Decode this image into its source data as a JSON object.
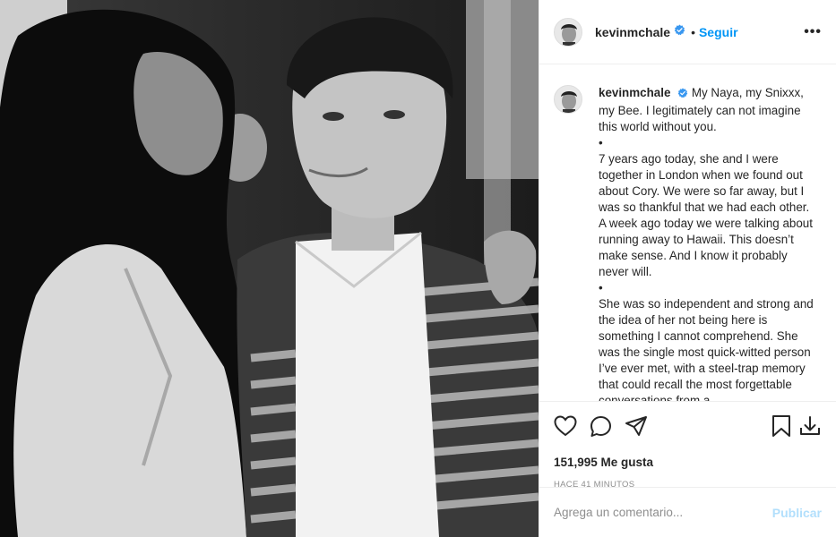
{
  "post": {
    "photo_icon": "black-and-white-photo",
    "header": {
      "username": "kevinmchale",
      "verified_icon": "verified-badge-icon",
      "separator": "•",
      "follow_label": "Seguir",
      "more_icon": "more-options-icon",
      "more_label": "•••"
    },
    "caption": {
      "username": "kevinmchale",
      "paragraphs": [
        "My Naya, my Snixxx, my Bee. I legitimately can not imagine this world without you.",
        "•",
        "7 years ago today, she and I were together in London when we found out about Cory. We were so far away, but I was so thankful that we had each other. A week ago today we were talking about running away to Hawaii. This doesn’t make sense. And I know it probably never will.",
        "•",
        "She was so independent and strong and the idea of her not being here is something I cannot comprehend. She was the single most quick-witted person I’ve ever met, with a steel-trap memory that could recall the most forgettable conversations from a"
      ]
    },
    "actions": {
      "like_icon": "heart-icon",
      "comment_icon": "comment-icon",
      "share_icon": "send-icon",
      "save_icon": "bookmark-icon",
      "download_icon": "download-icon"
    },
    "likes": "151,995 Me gusta",
    "time_ago": "HACE 41 MINUTOS",
    "comment_box": {
      "placeholder": "Agrega un comentario...",
      "publish_label": "Publicar"
    },
    "colors": {
      "accent": "#0095f6",
      "publish_disabled": "#b2dffc",
      "verified": "#3897f0"
    }
  }
}
